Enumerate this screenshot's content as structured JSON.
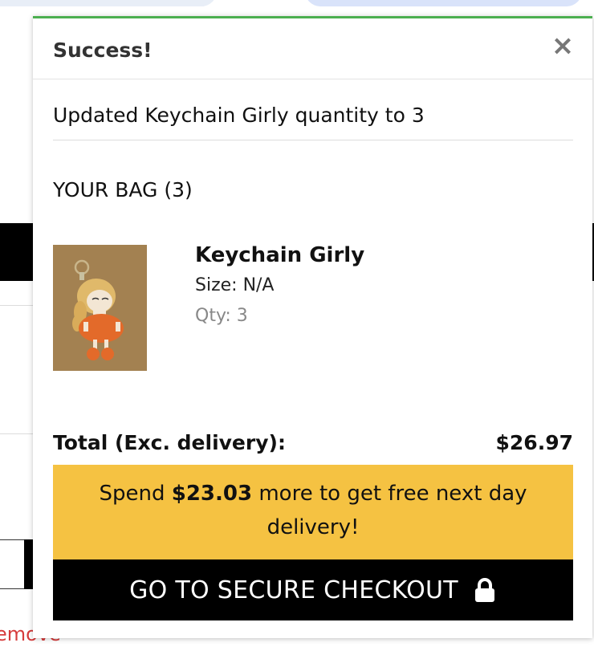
{
  "background": {
    "remove_link_fragment": "emove"
  },
  "popup": {
    "title": "Success!",
    "close_icon": "close-icon",
    "message": "Updated Keychain Girly quantity to 3",
    "bag_title": "YOUR BAG (3)",
    "accent_color": "#4caf50"
  },
  "item": {
    "name": "Keychain Girly",
    "size": "Size: N/A",
    "qty": "Qty: 3"
  },
  "total": {
    "label": "Total (Exc. delivery):",
    "value": "$26.97"
  },
  "promo": {
    "prefix": "Spend ",
    "amount": "$23.03",
    "suffix": " more to get free next day delivery!",
    "color": "#f5c242"
  },
  "checkout": {
    "label": "GO TO SECURE CHECKOUT",
    "icon": "lock-icon"
  }
}
